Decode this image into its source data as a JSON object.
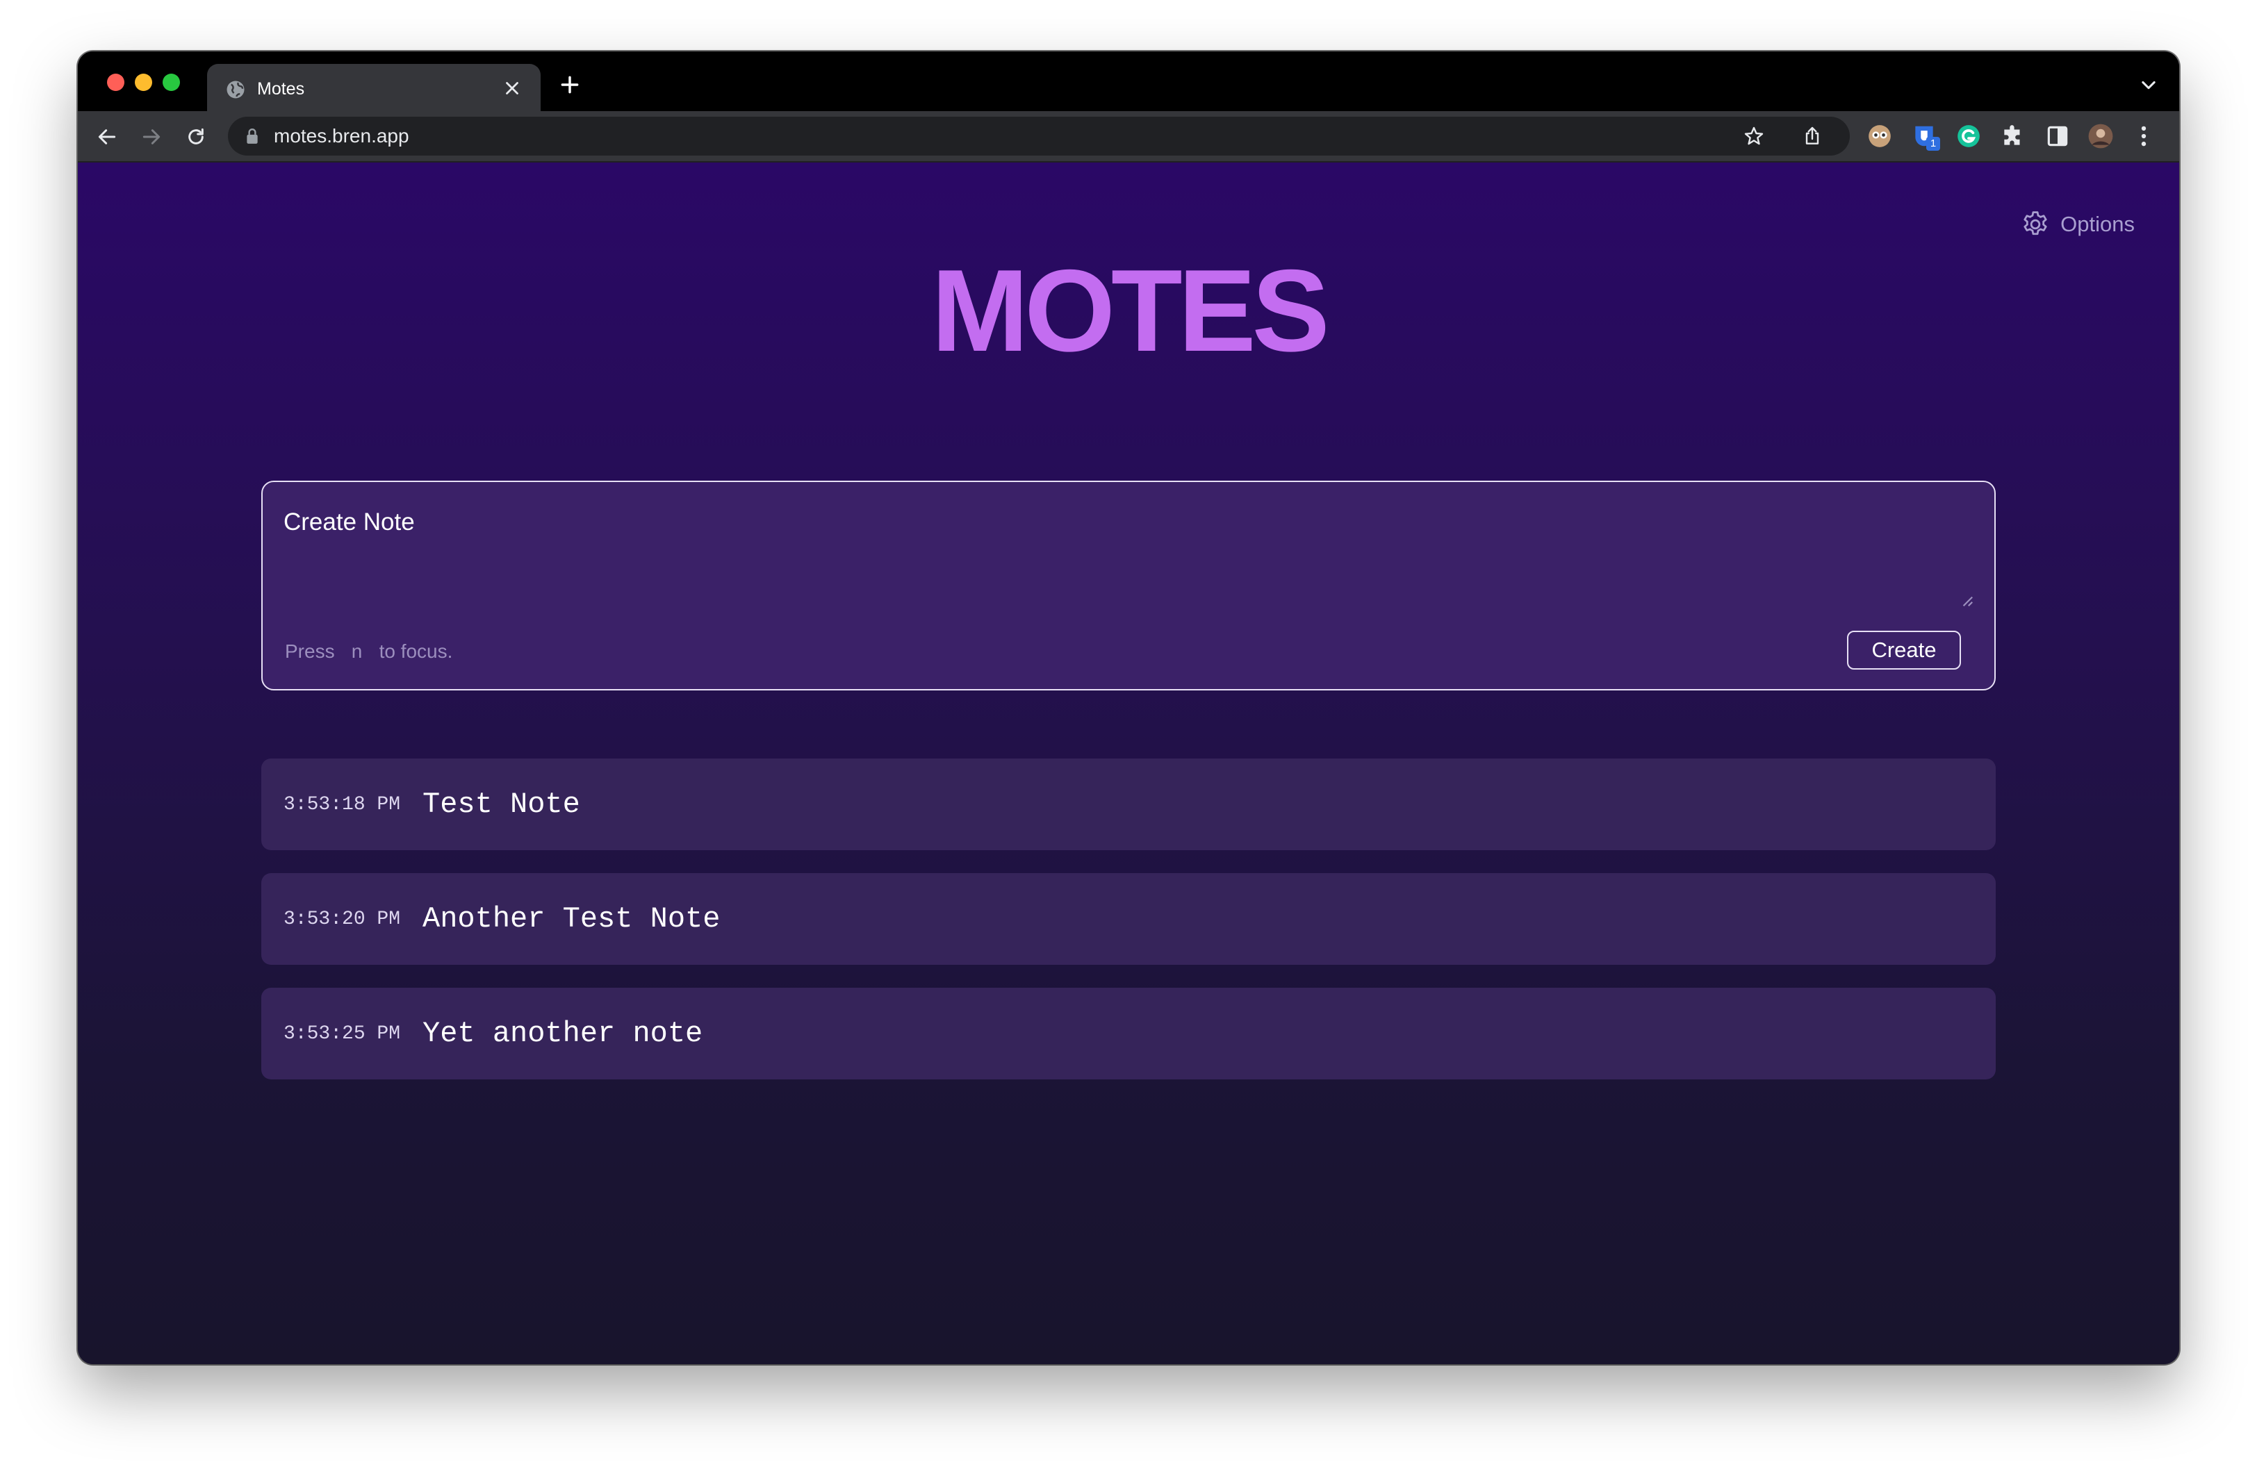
{
  "browser": {
    "tab_title": "Motes",
    "url": "motes.bren.app",
    "extension_badge": "1"
  },
  "page": {
    "options_label": "Options",
    "title": "MOTES",
    "create": {
      "placeholder": "Create Note",
      "hint_prefix": "Press",
      "hint_key": "n",
      "hint_suffix": "to focus.",
      "button_label": "Create"
    },
    "notes": [
      {
        "time": "3:53:18 PM",
        "text": "Test Note"
      },
      {
        "time": "3:53:20 PM",
        "text": "Another Test Note"
      },
      {
        "time": "3:53:25 PM",
        "text": "Yet another note"
      }
    ]
  },
  "colors": {
    "accent": "#c36df0",
    "page_top": "#2a0866",
    "page_bottom": "#18142c",
    "card": "#3b2168",
    "note_row": "#36245a"
  },
  "icons": [
    "globe-icon",
    "close-icon",
    "plus-icon",
    "chevron-down-icon",
    "back-arrow-icon",
    "forward-arrow-icon",
    "reload-icon",
    "lock-icon",
    "share-icon",
    "star-icon",
    "gear-icon",
    "puzzle-icon",
    "side-panel-icon",
    "kebab-menu-icon"
  ]
}
